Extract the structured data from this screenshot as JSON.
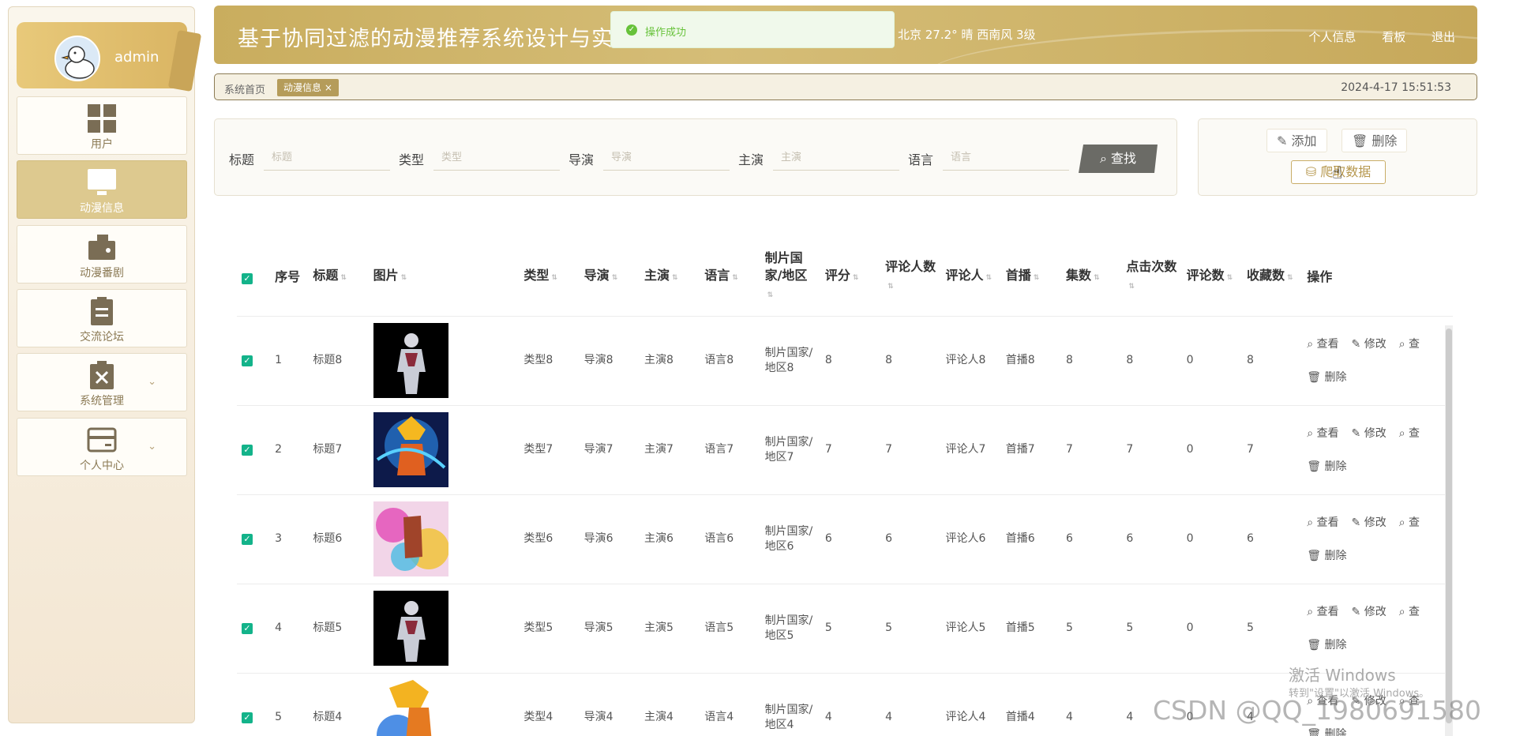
{
  "user": {
    "name": "admin"
  },
  "sidebar": {
    "items": [
      {
        "label": "用户",
        "icon": "grid-icon",
        "active": false,
        "expandable": false
      },
      {
        "label": "动漫信息",
        "icon": "monitor-icon",
        "active": true,
        "expandable": false
      },
      {
        "label": "动漫番剧",
        "icon": "wallet-icon",
        "active": false,
        "expandable": false
      },
      {
        "label": "交流论坛",
        "icon": "clipboard-icon",
        "active": false,
        "expandable": false
      },
      {
        "label": "系统管理",
        "icon": "delete-box-icon",
        "active": false,
        "expandable": true
      },
      {
        "label": "个人中心",
        "icon": "card-icon",
        "active": false,
        "expandable": true
      }
    ]
  },
  "header": {
    "title": "基于协同过滤的动漫推荐系统设计与实现",
    "weather": "北京  27.2°  晴  西南风  3级",
    "links": {
      "profile": "个人信息",
      "dashboard": "看板",
      "logout": "退出"
    }
  },
  "toast": {
    "message": "操作成功"
  },
  "breadcrumb": {
    "home": "系统首页",
    "tag": "动漫信息 ×",
    "datetime": "2024-4-17 15:51:53"
  },
  "search": {
    "fields": [
      {
        "label": "标题",
        "placeholder": "标题"
      },
      {
        "label": "类型",
        "placeholder": "类型"
      },
      {
        "label": "导演",
        "placeholder": "导演"
      },
      {
        "label": "主演",
        "placeholder": "主演"
      },
      {
        "label": "语言",
        "placeholder": "语言"
      }
    ],
    "button": "查找"
  },
  "actions": {
    "add": "添加",
    "delete": "删除",
    "crawl": "爬取数据"
  },
  "table": {
    "headers": {
      "index": "序号",
      "title": "标题",
      "image": "图片",
      "type": "类型",
      "director": "导演",
      "actor": "主演",
      "language": "语言",
      "region": "制片国家/地区",
      "score": "评分",
      "raters": "评论人数",
      "reviewer": "评论人",
      "premiere": "首播",
      "episodes": "集数",
      "clicks": "点击次数",
      "comments": "评论数",
      "favorites": "收藏数",
      "ops": "操作"
    },
    "ops": {
      "view": "查看",
      "edit": "修改",
      "more": "查",
      "delete": "删除"
    },
    "rows": [
      {
        "index": "1",
        "title": "标题8",
        "type": "类型8",
        "director": "导演8",
        "actor": "主演8",
        "language": "语言8",
        "region": "制片国家/地区8",
        "score": "8",
        "raters": "8",
        "reviewer": "评论人8",
        "premiere": "首播8",
        "episodes": "8",
        "clicks": "8",
        "comments": "0",
        "favorites": "8",
        "image": "armor"
      },
      {
        "index": "2",
        "title": "标题7",
        "type": "类型7",
        "director": "导演7",
        "actor": "主演7",
        "language": "语言7",
        "region": "制片国家/地区7",
        "score": "7",
        "raters": "7",
        "reviewer": "评论人7",
        "premiere": "首播7",
        "episodes": "7",
        "clicks": "7",
        "comments": "0",
        "favorites": "7",
        "image": "fire"
      },
      {
        "index": "3",
        "title": "标题6",
        "type": "类型6",
        "director": "导演6",
        "actor": "主演6",
        "language": "语言6",
        "region": "制片国家/地区6",
        "score": "6",
        "raters": "6",
        "reviewer": "评论人6",
        "premiere": "首播6",
        "episodes": "6",
        "clicks": "6",
        "comments": "0",
        "favorites": "6",
        "image": "colorful"
      },
      {
        "index": "4",
        "title": "标题5",
        "type": "类型5",
        "director": "导演5",
        "actor": "主演5",
        "language": "语言5",
        "region": "制片国家/地区5",
        "score": "5",
        "raters": "5",
        "reviewer": "评论人5",
        "premiere": "首播5",
        "episodes": "5",
        "clicks": "5",
        "comments": "0",
        "favorites": "5",
        "image": "armor"
      },
      {
        "index": "5",
        "title": "标题4",
        "type": "类型4",
        "director": "导演4",
        "actor": "主演4",
        "language": "语言4",
        "region": "制片国家/地区4",
        "score": "4",
        "raters": "4",
        "reviewer": "评论人4",
        "premiere": "首播4",
        "episodes": "4",
        "clicks": "4",
        "comments": "0",
        "favorites": "4",
        "image": "blue"
      }
    ]
  },
  "watermarks": {
    "windows_title": "激活 Windows",
    "windows_sub": "转到\"设置\"以激活 Windows。",
    "csdn": "CSDN @QQ_1980691580"
  },
  "colors": {
    "accent": "#c9ad5e",
    "active_menu": "#ddc98f",
    "checkbox": "#13b38a",
    "success": "#67c23a"
  }
}
